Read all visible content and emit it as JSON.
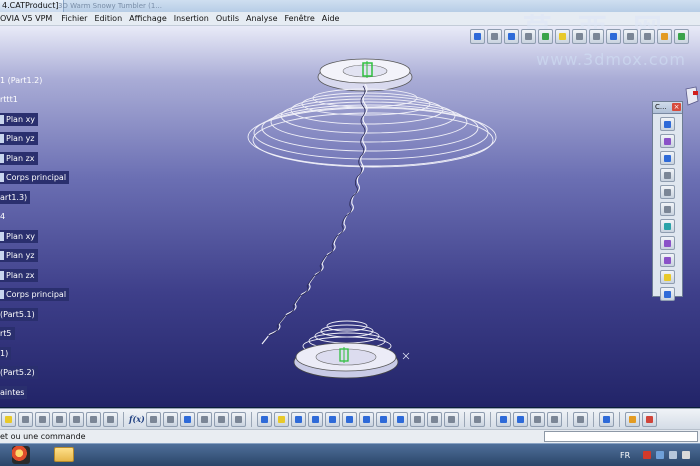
{
  "window": {
    "title_tab": "4.CATProduct]",
    "ghost_tab": "3D Warm Snowy Tumbler (1..."
  },
  "menu": {
    "items": [
      "OVIA V5 VPM",
      "Fichier",
      "Edition",
      "Affichage",
      "Insertion",
      "Outils",
      "Analyse",
      "Fenêtre",
      "Aide"
    ]
  },
  "watermark": {
    "chinese": "莫 西 网",
    "url": "www.3dmox.com"
  },
  "tree": {
    "nodes": [
      "1 (Part1.2)",
      "rttt1",
      "Plan xy",
      "Plan yz",
      "Plan zx",
      "Corps principal",
      "art1.3)",
      "4",
      "Plan xy",
      "Plan yz",
      "Plan zx",
      "Corps principal",
      "(Part5.1)",
      "rt5",
      "1)",
      "(Part5.2)",
      "aintes"
    ]
  },
  "float_toolbar": {
    "title": "C..."
  },
  "bottom_toolbar": {
    "formula_label": "f(x)"
  },
  "status": {
    "text": "et ou une commande"
  },
  "taskbar": {
    "language": "FR"
  },
  "icons": {
    "top_toolbar": [
      "product-icon",
      "balance-icon",
      "catalog-icon",
      "camera-icon",
      "spreadsheet-icon",
      "folder-icon",
      "plane-icon",
      "arrow-icon",
      "screen-icon",
      "sheet-icon",
      "measure-icon",
      "paint-icon",
      "edit-icon"
    ],
    "float_toolbar": [
      "sketch-icon",
      "pad-icon",
      "pocket-icon",
      "hole-icon",
      "rib-icon",
      "slot-icon",
      "stiffener-icon",
      "loft-icon",
      "shell-icon",
      "helix-icon",
      "pattern-icon"
    ]
  },
  "colors": {
    "viewport_top": "#e9ebf8",
    "viewport_bottom": "#222468",
    "tree_highlight": "#2a2f6e",
    "axis_green": "#2fbf3f"
  }
}
